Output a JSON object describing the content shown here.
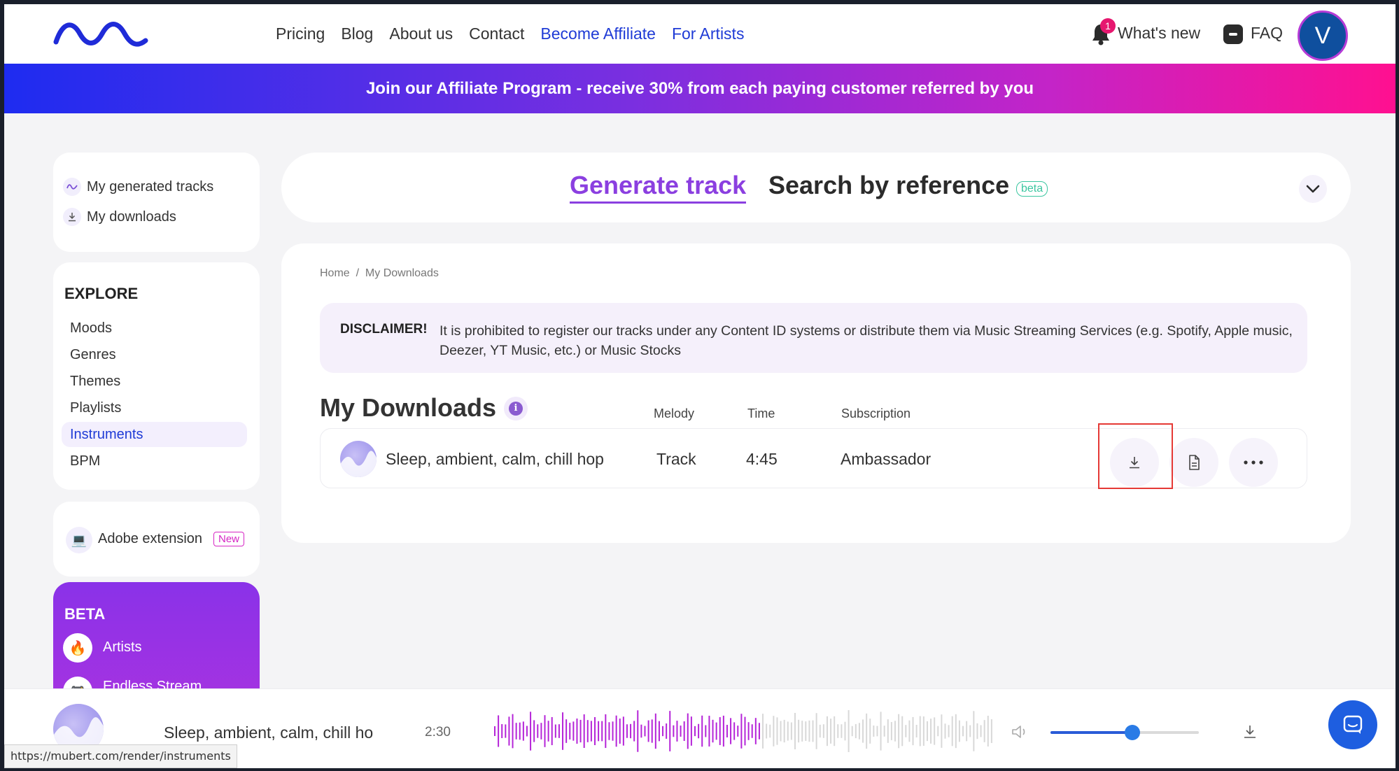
{
  "header": {
    "nav": [
      "Pricing",
      "Blog",
      "About us",
      "Contact",
      "Become Affiliate",
      "For Artists"
    ],
    "notification_count": "1",
    "whats_new": "What's new",
    "faq": "FAQ",
    "avatar_letter": "V"
  },
  "banner": {
    "text": "Join our Affiliate Program - receive 30% from each paying customer referred by you"
  },
  "sidebar": {
    "my_links": [
      "My generated tracks",
      "My downloads"
    ],
    "explore_title": "EXPLORE",
    "explore_items": [
      "Moods",
      "Genres",
      "Themes",
      "Playlists",
      "Instruments",
      "BPM"
    ],
    "explore_active": "Instruments",
    "adobe": "Adobe extension",
    "adobe_badge": "New",
    "beta_title": "BETA",
    "beta_items": [
      "Artists",
      "Endless Stream"
    ]
  },
  "generator": {
    "tab_active": "Generate track",
    "tab_other": "Search by reference",
    "beta_badge": "beta"
  },
  "main": {
    "breadcrumb": [
      "Home",
      "My Downloads"
    ],
    "breadcrumb_sep": "/",
    "disclaimer_label": "DISCLAIMER!",
    "disclaimer_text": "It is prohibited to register our tracks under any Content ID systems or distribute them via Music Streaming Services (e.g. Spotify, Apple music, Deezer, YT Music, etc.) or Music Stocks",
    "title": "My Downloads",
    "columns": [
      "Melody",
      "Time",
      "Subscription"
    ],
    "rows": [
      {
        "name": "Sleep, ambient, calm, chill hop",
        "melody": "Track",
        "time": "4:45",
        "subscription": "Ambassador"
      }
    ]
  },
  "player": {
    "title": "Sleep, ambient, calm, chill ho",
    "time": "2:30",
    "progress": 0.53,
    "volume": 0.55
  },
  "status_url": "https://mubert.com/render/instruments",
  "colors": {
    "accent_purple": "#8b3fe0",
    "link_blue": "#1f3bd6",
    "wave_played": "#b524d8",
    "wave_unplayed": "#d8d8d8"
  }
}
